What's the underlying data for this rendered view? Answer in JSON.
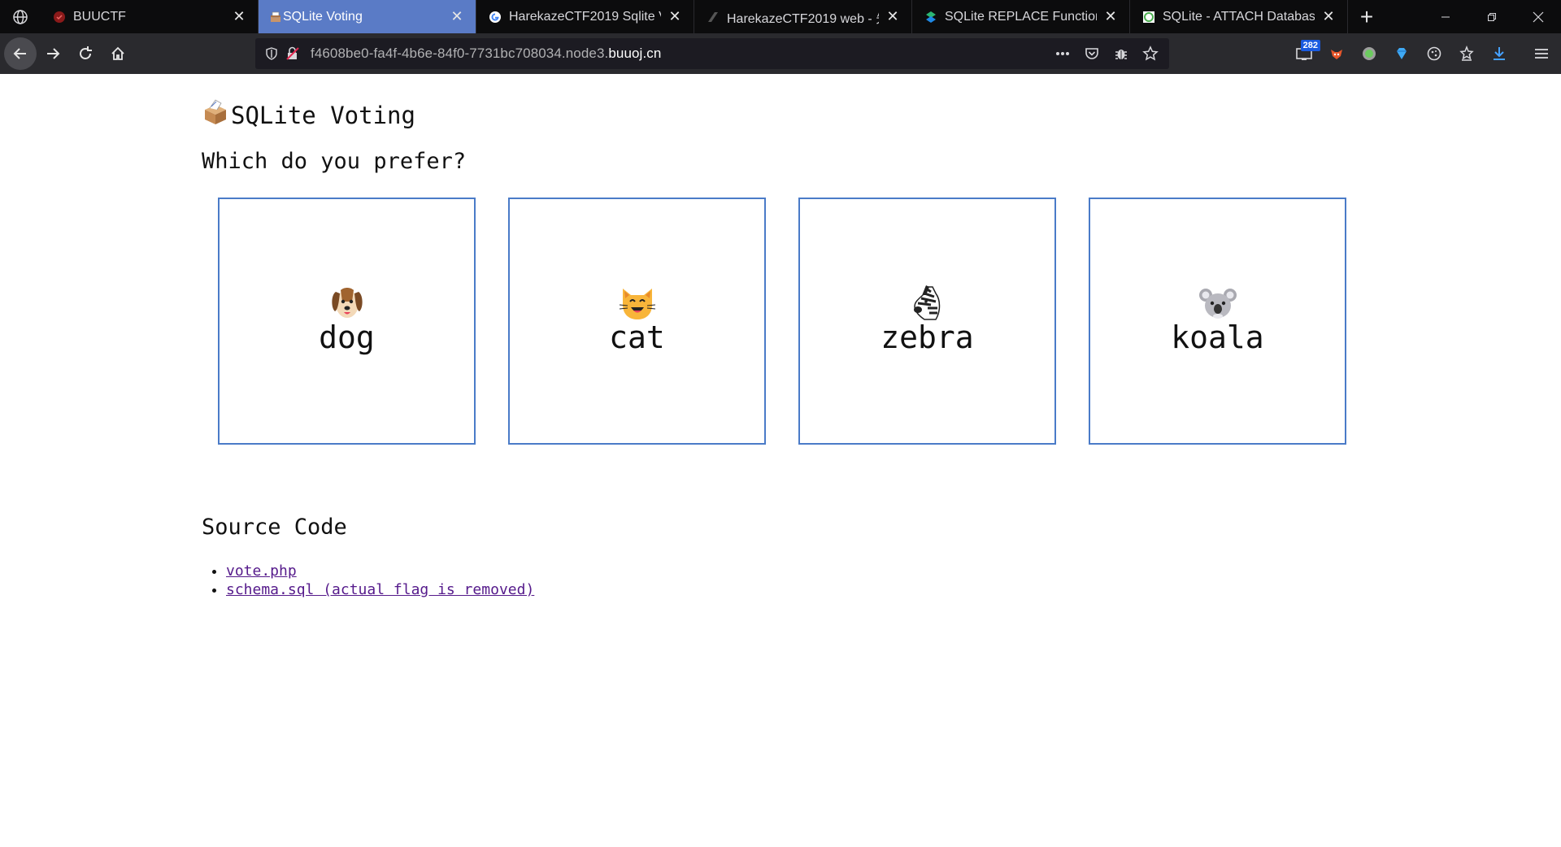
{
  "browser": {
    "tabs": [
      {
        "title": "BUUCTF",
        "active": false,
        "icon": "buuctf-icon"
      },
      {
        "title": "SQLite Voting",
        "active": true,
        "icon": "ballot-box-icon"
      },
      {
        "title": "HarekazeCTF2019 Sqlite V",
        "active": false,
        "icon": "google-icon"
      },
      {
        "title": "HarekazeCTF2019 web - 先",
        "active": false,
        "icon": "page-icon"
      },
      {
        "title": "SQLite REPLACE Function",
        "active": false,
        "icon": "sqlite-tutorial-icon"
      },
      {
        "title": "SQLite - ATTACH Database",
        "active": false,
        "icon": "tutorialspoint-icon"
      }
    ],
    "url_prefix": "f4608be0-fa4f-4b6e-84f0-7731bc708034.node3.",
    "url_domain": "buuoj.cn",
    "extension_badge": "282"
  },
  "page": {
    "title": "SQLite Voting",
    "title_icon": "ballot-box-icon",
    "question": "Which do you prefer?",
    "options": [
      {
        "name": "dog",
        "icon": "dog-face-icon"
      },
      {
        "name": "cat",
        "icon": "cat-face-icon"
      },
      {
        "name": "zebra",
        "icon": "zebra-face-icon"
      },
      {
        "name": "koala",
        "icon": "koala-face-icon"
      }
    ],
    "source_heading": "Source Code",
    "source_links": [
      "vote.php",
      "schema.sql (actual flag is removed)"
    ]
  },
  "colors": {
    "tab_active": "#5a7bc6",
    "card_border": "#4a7bc8",
    "link_visited": "#551a8b"
  }
}
